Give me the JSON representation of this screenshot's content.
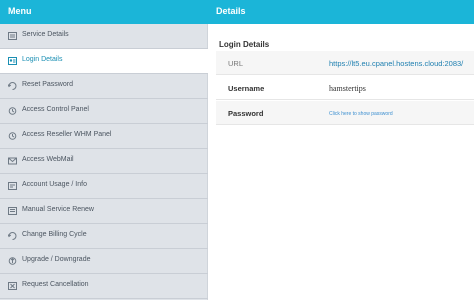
{
  "header": {
    "menu_title": "Menu",
    "details_title": "Details"
  },
  "sidebar": {
    "items": [
      {
        "label": "Service Details",
        "icon": "service-details-icon"
      },
      {
        "label": "Login Details",
        "icon": "login-details-icon",
        "active": true
      },
      {
        "label": "Reset Password",
        "icon": "reset-password-icon"
      },
      {
        "label": "Access Control Panel",
        "icon": "control-panel-icon"
      },
      {
        "label": "Access Reseller WHM Panel",
        "icon": "whm-panel-icon"
      },
      {
        "label": "Access WebMail",
        "icon": "webmail-icon"
      },
      {
        "label": "Account Usage / Info",
        "icon": "account-usage-icon"
      },
      {
        "label": "Manual Service Renew",
        "icon": "service-renew-icon"
      },
      {
        "label": "Change Billing Cycle",
        "icon": "billing-cycle-icon"
      },
      {
        "label": "Upgrade / Downgrade",
        "icon": "upgrade-icon"
      },
      {
        "label": "Request Cancellation",
        "icon": "cancellation-icon"
      }
    ]
  },
  "details": {
    "section_title": "Login Details",
    "url_label": "URL",
    "url_value": "https://lt5.eu.cpanel.hostens.cloud:2083/",
    "username_label": "Username",
    "username_value": "hamstertips",
    "password_label": "Password",
    "password_link": "Click here to show password"
  },
  "colors": {
    "accent": "#1bb5d8",
    "sidebar_bg": "#dfe3e8",
    "link": "#1e7fb0"
  }
}
